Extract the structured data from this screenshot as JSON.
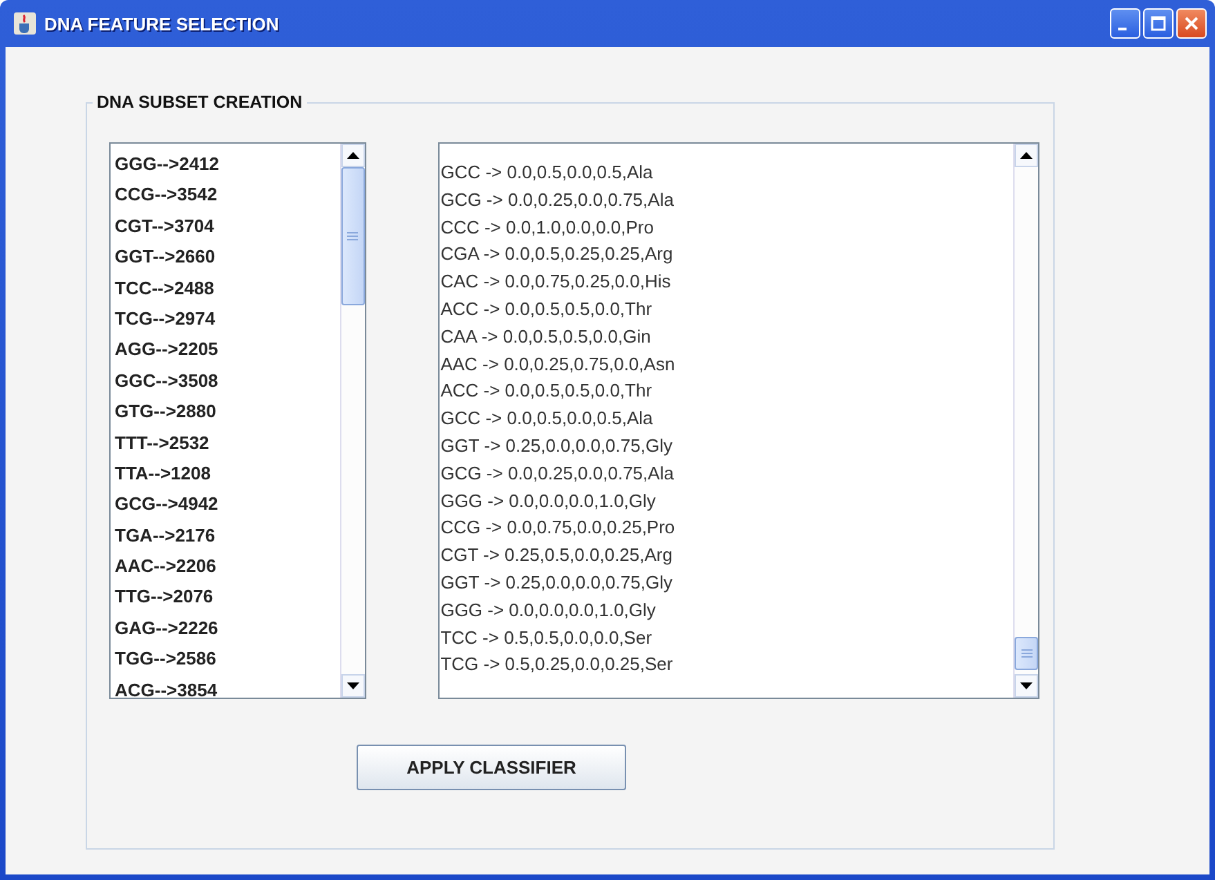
{
  "window": {
    "title": "DNA FEATURE SELECTION"
  },
  "panel": {
    "title": "DNA SUBSET CREATION"
  },
  "codon_list": [
    "GGG-->2412",
    "CCG-->3542",
    "CGT-->3704",
    "GGT-->2660",
    "TCC-->2488",
    "TCG-->2974",
    "AGG-->2205",
    "GGC-->3508",
    "GTG-->2880",
    "TTT-->2532",
    "TTA-->1208",
    "GCG-->4942",
    "TGA-->2176",
    "AAC-->2206",
    "TTG-->2076",
    "GAG-->2226",
    "TGG-->2586",
    "ACG-->3854"
  ],
  "feature_lines": [
    "GCC -> 0.0,0.5,0.0,0.5,Ala",
    "GCG -> 0.0,0.25,0.0,0.75,Ala",
    "CCC -> 0.0,1.0,0.0,0.0,Pro",
    "CGA -> 0.0,0.5,0.25,0.25,Arg",
    "CAC -> 0.0,0.75,0.25,0.0,His",
    "ACC -> 0.0,0.5,0.5,0.0,Thr",
    "CAA -> 0.0,0.5,0.5,0.0,Gin",
    "AAC -> 0.0,0.25,0.75,0.0,Asn",
    "ACC -> 0.0,0.5,0.5,0.0,Thr",
    "GCC -> 0.0,0.5,0.0,0.5,Ala",
    "GGT -> 0.25,0.0,0.0,0.75,Gly",
    "GCG -> 0.0,0.25,0.0,0.75,Ala",
    "GGG -> 0.0,0.0,0.0,1.0,Gly",
    "CCG -> 0.0,0.75,0.0,0.25,Pro",
    "CGT -> 0.25,0.5,0.0,0.25,Arg",
    "GGT -> 0.25,0.0,0.0,0.75,Gly",
    "GGG -> 0.0,0.0,0.0,1.0,Gly",
    "TCC -> 0.5,0.5,0.0,0.0,Ser",
    "TCG -> 0.5,0.25,0.0,0.25,Ser"
  ],
  "buttons": [
    "APPLY CLASSIFIER"
  ]
}
